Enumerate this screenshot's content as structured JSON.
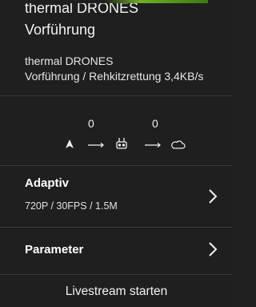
{
  "header": {
    "title_line1": "thermal DRONES",
    "title_line2": "Vorführung"
  },
  "meta": {
    "line1": "thermal DRONES",
    "line2": "Vorführung / Rehkitzrettung 3,4KB/s"
  },
  "link": {
    "count_left": "0",
    "count_right": "0",
    "icons": [
      "aircraft-arrow-icon",
      "arrow-right-icon",
      "controller-icon",
      "arrow-right-icon",
      "cloud-icon"
    ]
  },
  "quality": {
    "title": "Adaptiv",
    "detail": "720P / 30FPS / 1.5M"
  },
  "parameter": {
    "title": "Parameter"
  },
  "action": {
    "start_label": "Livestream starten"
  },
  "colors": {
    "background": "#1f1f1f",
    "accent": "#6fae24",
    "divider": "#3a3a3a"
  }
}
